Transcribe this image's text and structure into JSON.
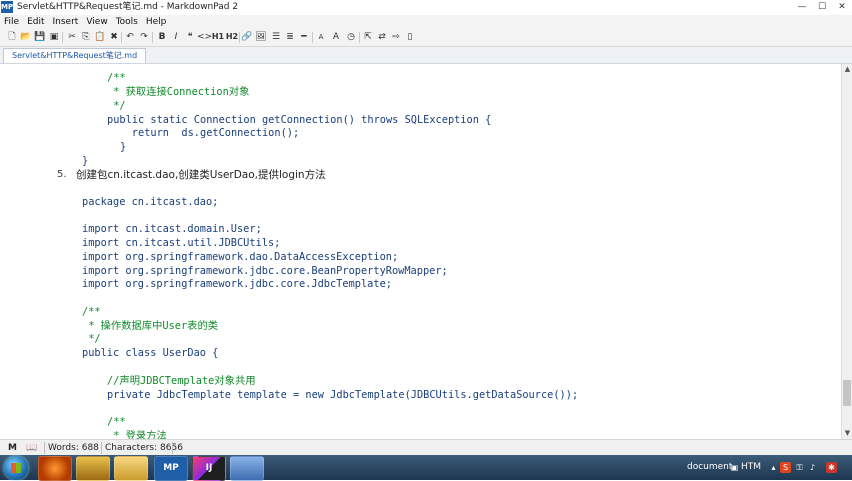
{
  "window": {
    "title": "Servlet&HTTP&Request笔记.md - MarkdownPad 2",
    "app_icon": "MP",
    "minimize": "—",
    "maximize": "☐",
    "close": "✕"
  },
  "menu": [
    "File",
    "Edit",
    "Insert",
    "View",
    "Tools",
    "Help"
  ],
  "toolbar": {
    "h1": "H1",
    "h2": "H2",
    "font_a_small": "A",
    "font_a_large": "A"
  },
  "tab": {
    "label": "Servlet&HTTP&Request笔记.md"
  },
  "editor": {
    "lines": [
      {
        "text": "/**",
        "style": "cmt"
      },
      {
        "text": " * 获取连接Connection对象",
        "style": "cmt"
      },
      {
        "text": " */",
        "style": "cmt"
      },
      {
        "text": "public static Connection getConnection() throws SQLException {",
        "style": "code"
      },
      {
        "text": "    return  ds.getConnection();",
        "style": "code"
      },
      {
        "text": "}",
        "style": "code"
      },
      {
        "text": "}",
        "style": "code"
      },
      {
        "text": "创建包cn.itcast.dao,创建类UserDao,提供login方法",
        "style": "text"
      },
      {
        "text": "package cn.itcast.dao;",
        "style": "code"
      },
      {
        "text": "import cn.itcast.domain.User;",
        "style": "code"
      },
      {
        "text": "import cn.itcast.util.JDBCUtils;",
        "style": "code"
      },
      {
        "text": "import org.springframework.dao.DataAccessException;",
        "style": "code"
      },
      {
        "text": "import org.springframework.jdbc.core.BeanPropertyRowMapper;",
        "style": "code"
      },
      {
        "text": "import org.springframework.jdbc.core.JdbcTemplate;",
        "style": "code"
      },
      {
        "text": "/**",
        "style": "cmt"
      },
      {
        "text": " * 操作数据库中User表的类",
        "style": "cmt"
      },
      {
        "text": " */",
        "style": "cmt"
      },
      {
        "text": "public class UserDao {",
        "style": "code"
      },
      {
        "text": "//声明JDBCTemplate对象共用",
        "style": "cmt"
      },
      {
        "text": "private JdbcTemplate template = new JdbcTemplate(JDBCUtils.getDataSource());",
        "style": "code"
      },
      {
        "text": "/**",
        "style": "cmt"
      },
      {
        "text": " * 登录方法",
        "style": "cmt"
      }
    ],
    "list_number": "5."
  },
  "status": {
    "words": "Words: 688",
    "characters": "Characters: 8656"
  },
  "taskbar": {
    "apps": [
      "",
      "",
      "",
      "MP",
      "IJ",
      ""
    ],
    "tray_text": "document",
    "tray_htm": "HTM"
  },
  "colors": {
    "code": "#1a3f7a",
    "comment": "#118a2a",
    "accent": "#1a56a8"
  }
}
